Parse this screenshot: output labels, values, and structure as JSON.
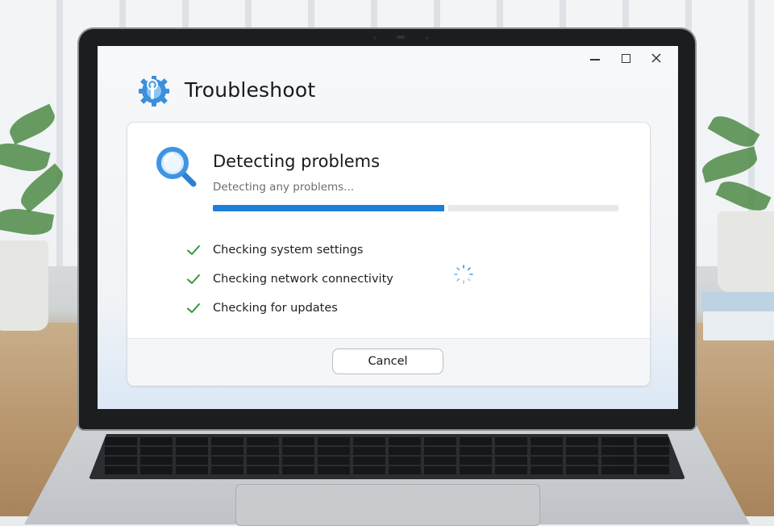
{
  "app": {
    "title": "Troubleshoot",
    "icon": "gear-wrench-icon",
    "window_controls": [
      "minimize",
      "maximize",
      "close"
    ]
  },
  "panel": {
    "icon": "magnifier-icon",
    "heading": "Detecting problems",
    "subtext": "Detecting any problems...",
    "progress": 0.57,
    "checks": [
      {
        "label": "Checking system settings",
        "status": "done"
      },
      {
        "label": "Checking network connectivity",
        "status": "done"
      },
      {
        "label": "Checking for updates",
        "status": "done"
      }
    ],
    "spinner": "loading-spinner",
    "cancel_label": "Cancel"
  },
  "colors": {
    "accent": "#1e7fd8",
    "check": "#2e9a3a",
    "track": "#e7e8ea"
  }
}
